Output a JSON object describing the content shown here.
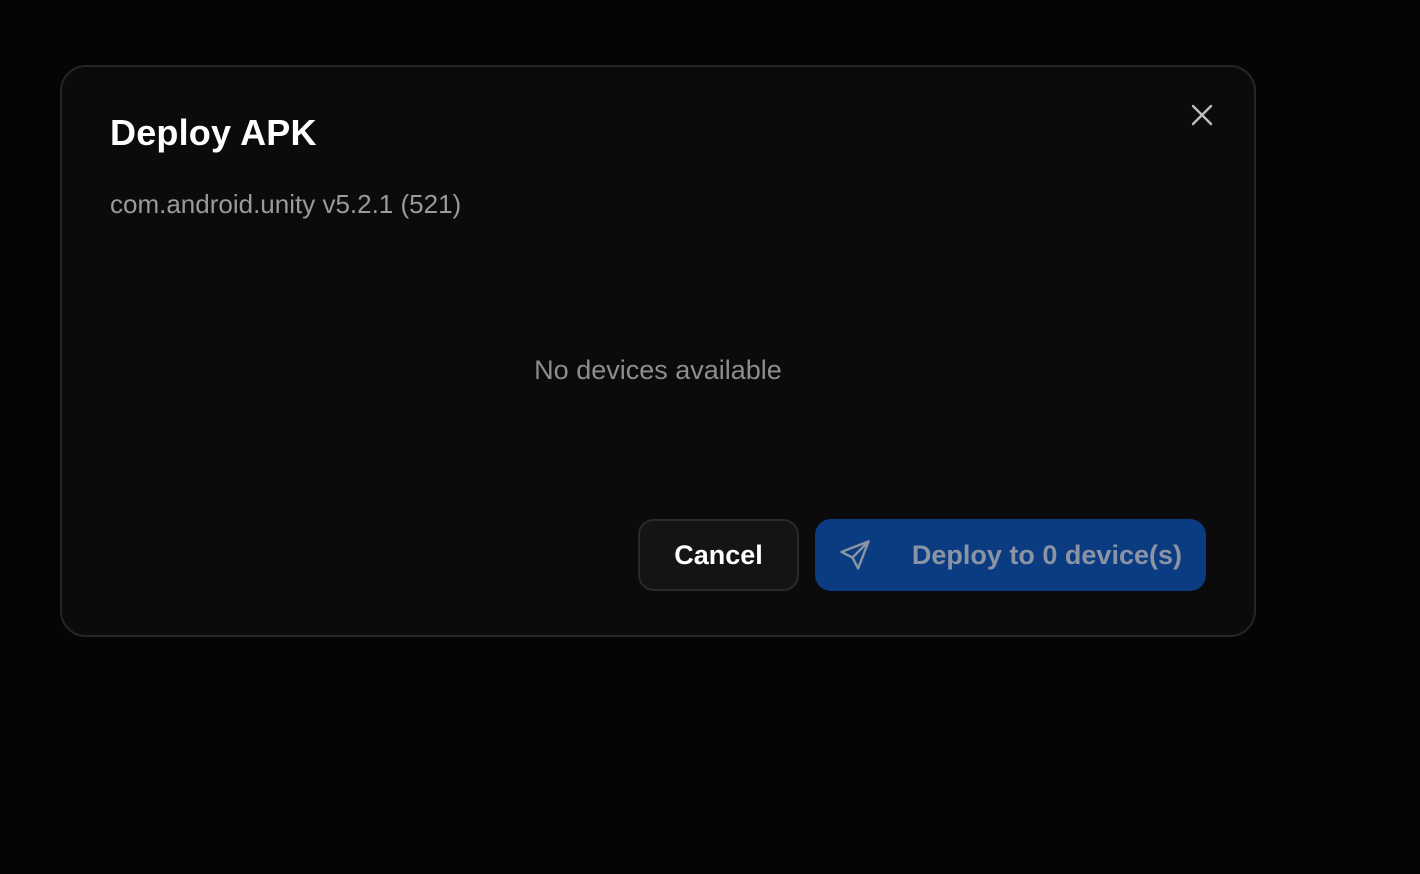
{
  "dialog": {
    "title": "Deploy APK",
    "subtitle": "com.android.unity v5.2.1 (521)",
    "empty_message": "No devices available",
    "close_icon": "close-icon",
    "actions": {
      "cancel_label": "Cancel",
      "deploy_label": "Deploy to 0 device(s)",
      "deploy_icon": "send-icon",
      "deploy_disabled": true
    }
  },
  "colors": {
    "background": "#050505",
    "dialog_bg": "#0b0b0b",
    "primary": "#0b3b80",
    "muted_text": "#9a9a9a"
  }
}
